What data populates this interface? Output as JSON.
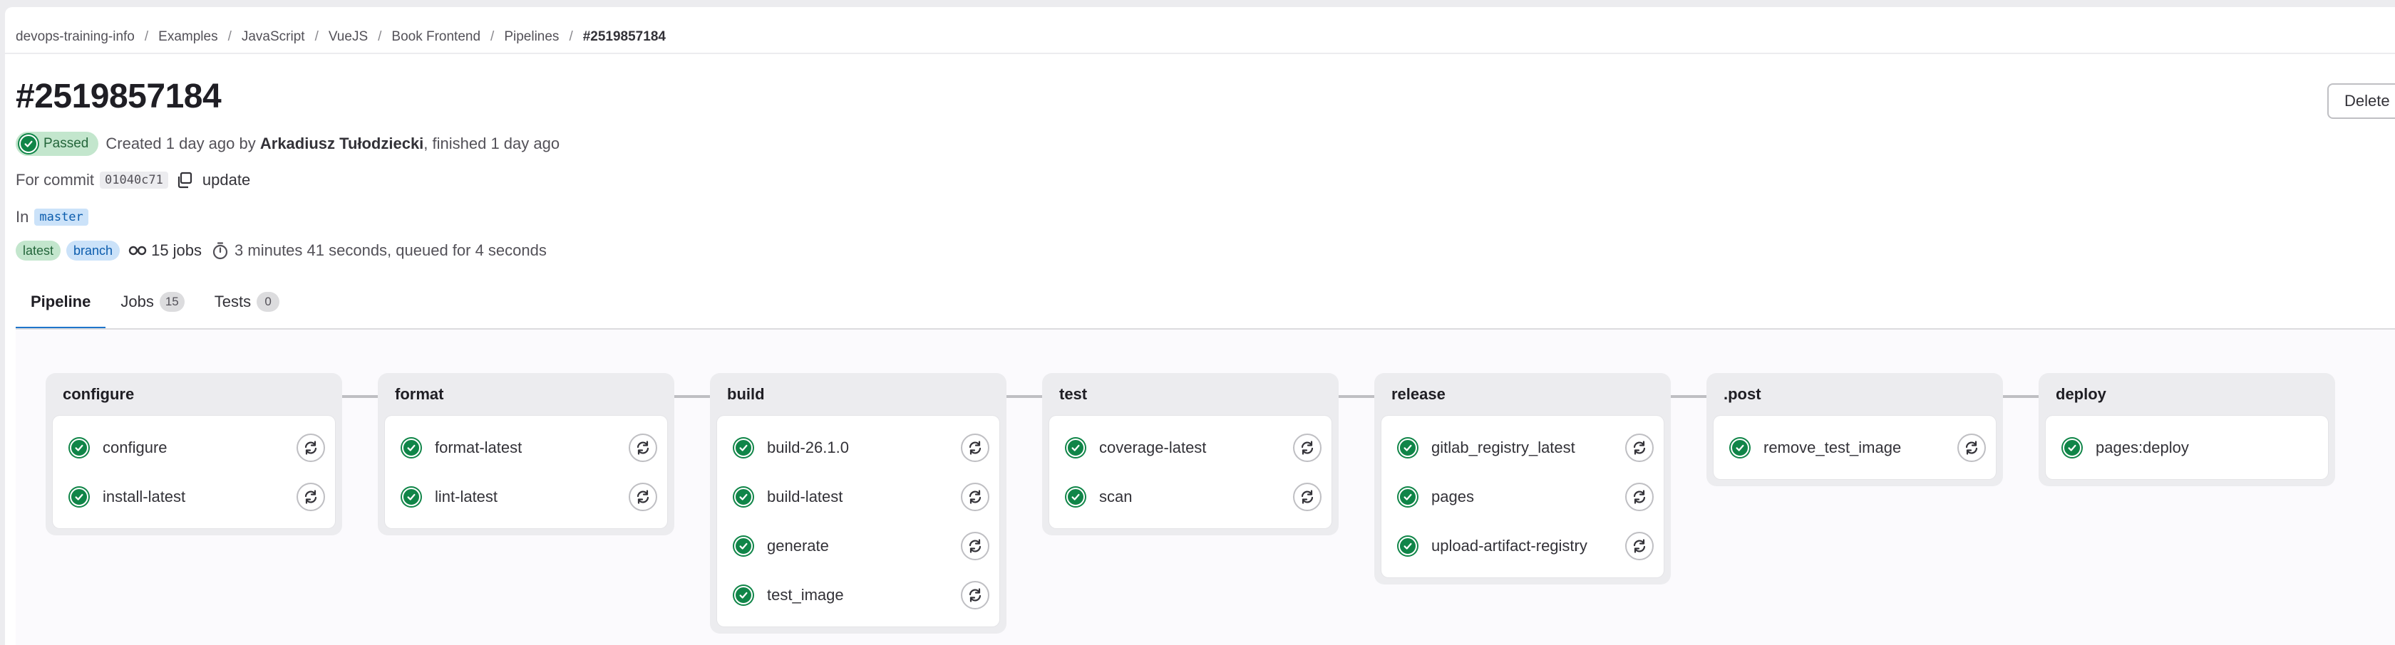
{
  "breadcrumb": [
    "devops-training-info",
    "Examples",
    "JavaScript",
    "VueJS",
    "Book Frontend",
    "Pipelines",
    "#2519857184"
  ],
  "pipeline": {
    "title": "#2519857184",
    "status": "Passed",
    "created_text": "Created 1 day ago by",
    "author": "Arkadiusz Tułodziecki",
    "finished_text": ", finished 1 day ago",
    "commit_prefix": "For commit",
    "commit_sha": "01040c71",
    "commit_message": "update",
    "branch_prefix": "In",
    "branch": "master",
    "tags": [
      "latest",
      "branch"
    ],
    "jobs_count": "15 jobs",
    "duration": "3 minutes 41 seconds, queued for 4 seconds"
  },
  "actions": {
    "delete_label": "Delete"
  },
  "tabs": [
    {
      "label": "Pipeline",
      "count": null
    },
    {
      "label": "Jobs",
      "count": "15"
    },
    {
      "label": "Tests",
      "count": "0"
    }
  ],
  "stages": [
    {
      "name": "configure",
      "jobs": [
        "configure",
        "install-latest"
      ]
    },
    {
      "name": "format",
      "jobs": [
        "format-latest",
        "lint-latest"
      ]
    },
    {
      "name": "build",
      "jobs": [
        "build-26.1.0",
        "build-latest",
        "generate",
        "test_image"
      ]
    },
    {
      "name": "test",
      "jobs": [
        "coverage-latest",
        "scan"
      ]
    },
    {
      "name": "release",
      "jobs": [
        "gitlab_registry_latest",
        "pages",
        "upload-artifact-registry"
      ]
    },
    {
      "name": ".post",
      "jobs": [
        "remove_test_image"
      ]
    },
    {
      "name": "deploy",
      "jobs": [
        "pages:deploy"
      ]
    }
  ],
  "colors": {
    "success": "#108548",
    "accent": "#1f75cb"
  },
  "icons": {
    "job_status": "check-circle-icon",
    "job_action": "retry-icon",
    "copy": "copy-icon",
    "jobs": "pipeline-icon",
    "duration": "timer-icon"
  }
}
